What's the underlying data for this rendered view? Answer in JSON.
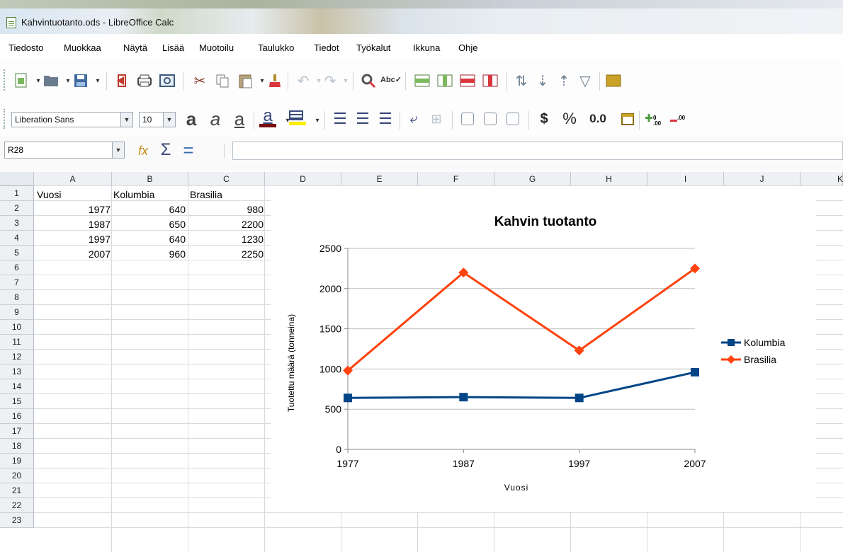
{
  "window": {
    "title": "Kahvintuotanto.ods - LibreOffice Calc"
  },
  "menu": [
    "Tiedosto",
    "Muokkaa",
    "Näytä",
    "Lisää",
    "Muotoilu",
    "Taulukko",
    "Tiedot",
    "Työkalut",
    "Ikkuna",
    "Ohje"
  ],
  "format_bar": {
    "font_name": "Liberation Sans",
    "font_size": "10",
    "currency_symbol": "$",
    "percent_symbol": "%",
    "number_format": "0.0",
    "add_decimal": "0\n.00",
    "delete_decimal": ".00"
  },
  "name_box": "R28",
  "columns": [
    "A",
    "B",
    "C",
    "D",
    "E",
    "F",
    "G",
    "H",
    "I",
    "J",
    "K"
  ],
  "rows": [
    "1",
    "2",
    "3",
    "4",
    "5",
    "6",
    "7",
    "8",
    "9",
    "10",
    "11",
    "12",
    "13",
    "14",
    "15",
    "16",
    "17",
    "18",
    "19",
    "20",
    "21",
    "22",
    "23"
  ],
  "cells": {
    "header": [
      "Vuosi",
      "Kolumbia",
      "Brasilia"
    ],
    "data": [
      [
        "1977",
        "640",
        "980"
      ],
      [
        "1987",
        "650",
        "2200"
      ],
      [
        "1997",
        "640",
        "1230"
      ],
      [
        "2007",
        "960",
        "2250"
      ]
    ]
  },
  "chart_data": {
    "type": "line",
    "title": "Kahvin tuotanto",
    "xlabel": "Vuosi",
    "ylabel": "Tuotettu määrä (tonneina)",
    "categories": [
      "1977",
      "1987",
      "1997",
      "2007"
    ],
    "y_ticks": [
      "0",
      "500",
      "1000",
      "1500",
      "2000",
      "2500"
    ],
    "ylim": [
      0,
      2500
    ],
    "grid": true,
    "legend_position": "right",
    "series": [
      {
        "name": "Kolumbia",
        "values": [
          640,
          650,
          640,
          960
        ],
        "color": "#004586",
        "marker": "square"
      },
      {
        "name": "Brasilia",
        "values": [
          980,
          2200,
          1230,
          2250
        ],
        "color": "#ff420e",
        "marker": "diamond"
      }
    ]
  }
}
